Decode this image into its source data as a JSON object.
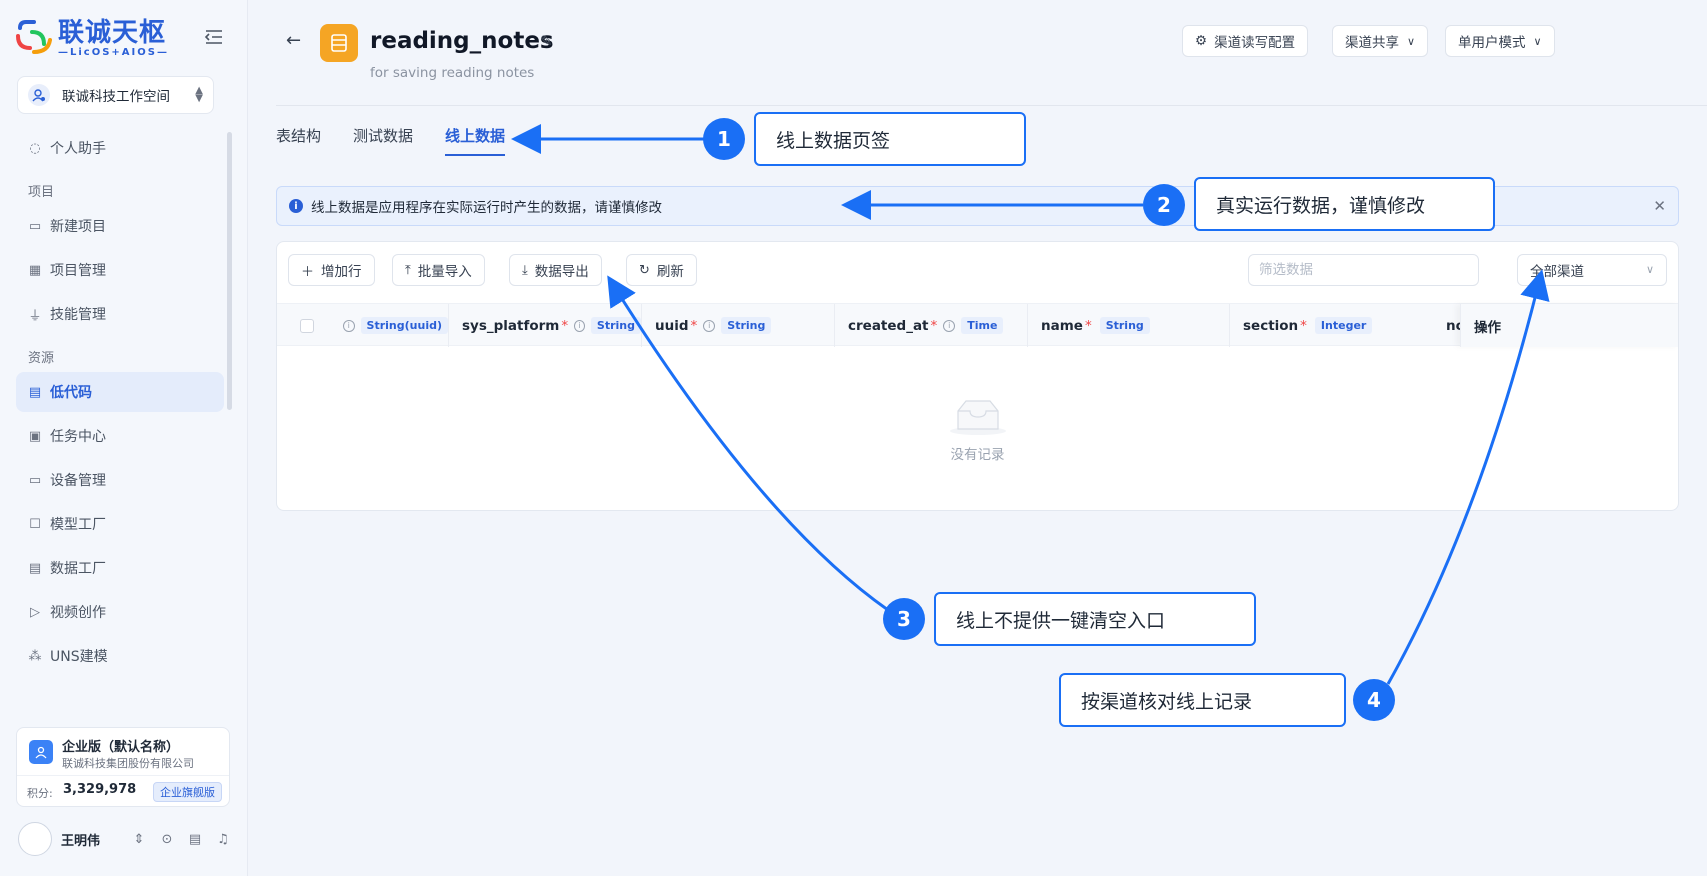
{
  "sidebar": {
    "logo_title": "联诚天枢",
    "logo_subtitle": "—LicOS+AIOS—",
    "workspace": "联诚科技工作空间",
    "items": [
      {
        "label": "个人助手"
      },
      {
        "section": "项目"
      },
      {
        "label": "新建项目"
      },
      {
        "label": "项目管理"
      },
      {
        "label": "技能管理"
      },
      {
        "section": "资源"
      },
      {
        "label": "低代码",
        "active": true
      },
      {
        "label": "任务中心"
      },
      {
        "label": "设备管理"
      },
      {
        "label": "模型工厂"
      },
      {
        "label": "数据工厂"
      },
      {
        "label": "视频创作"
      },
      {
        "label": "UNS建模"
      }
    ],
    "enterprise": {
      "name": "企业版（默认名称）",
      "company": "联诚科技集团股份有限公司",
      "points_label": "积分:",
      "points": "3,329,978",
      "badge": "企业旗舰版"
    },
    "user": {
      "name": "王明伟"
    }
  },
  "header": {
    "title": "reading_notes",
    "subtitle": "for saving reading notes",
    "buttons": {
      "config": "渠道读写配置",
      "share": "渠道共享",
      "mode": "单用户模式"
    }
  },
  "tabs": [
    "表结构",
    "测试数据",
    "线上数据"
  ],
  "alert": "线上数据是应用程序在实际运行时产生的数据，请谨慎修改",
  "toolbar": {
    "add_row": "增加行",
    "batch_import": "批量导入",
    "export": "数据导出",
    "refresh": "刷新",
    "filter_placeholder": "筛选数据",
    "channel": "全部渠道"
  },
  "columns": [
    {
      "name": "",
      "type": "String(uuid)"
    },
    {
      "name": "sys_platform",
      "type": "String"
    },
    {
      "name": "uuid",
      "type": "String"
    },
    {
      "name": "created_at",
      "type": "Time"
    },
    {
      "name": "name",
      "type": "String"
    },
    {
      "name": "section",
      "type": "Integer"
    },
    {
      "name": "no"
    },
    {
      "name": "操作"
    }
  ],
  "empty_text": "没有记录",
  "callouts": [
    {
      "n": "1",
      "text": "线上数据页签"
    },
    {
      "n": "2",
      "text": "真实运行数据，谨慎修改"
    },
    {
      "n": "3",
      "text": "线上不提供一键清空入口"
    },
    {
      "n": "4",
      "text": "按渠道核对线上记录"
    }
  ],
  "colors": {
    "accent": "#2a5fd6",
    "callout": "#1a6ff5",
    "app_icon": "#f5a524"
  }
}
